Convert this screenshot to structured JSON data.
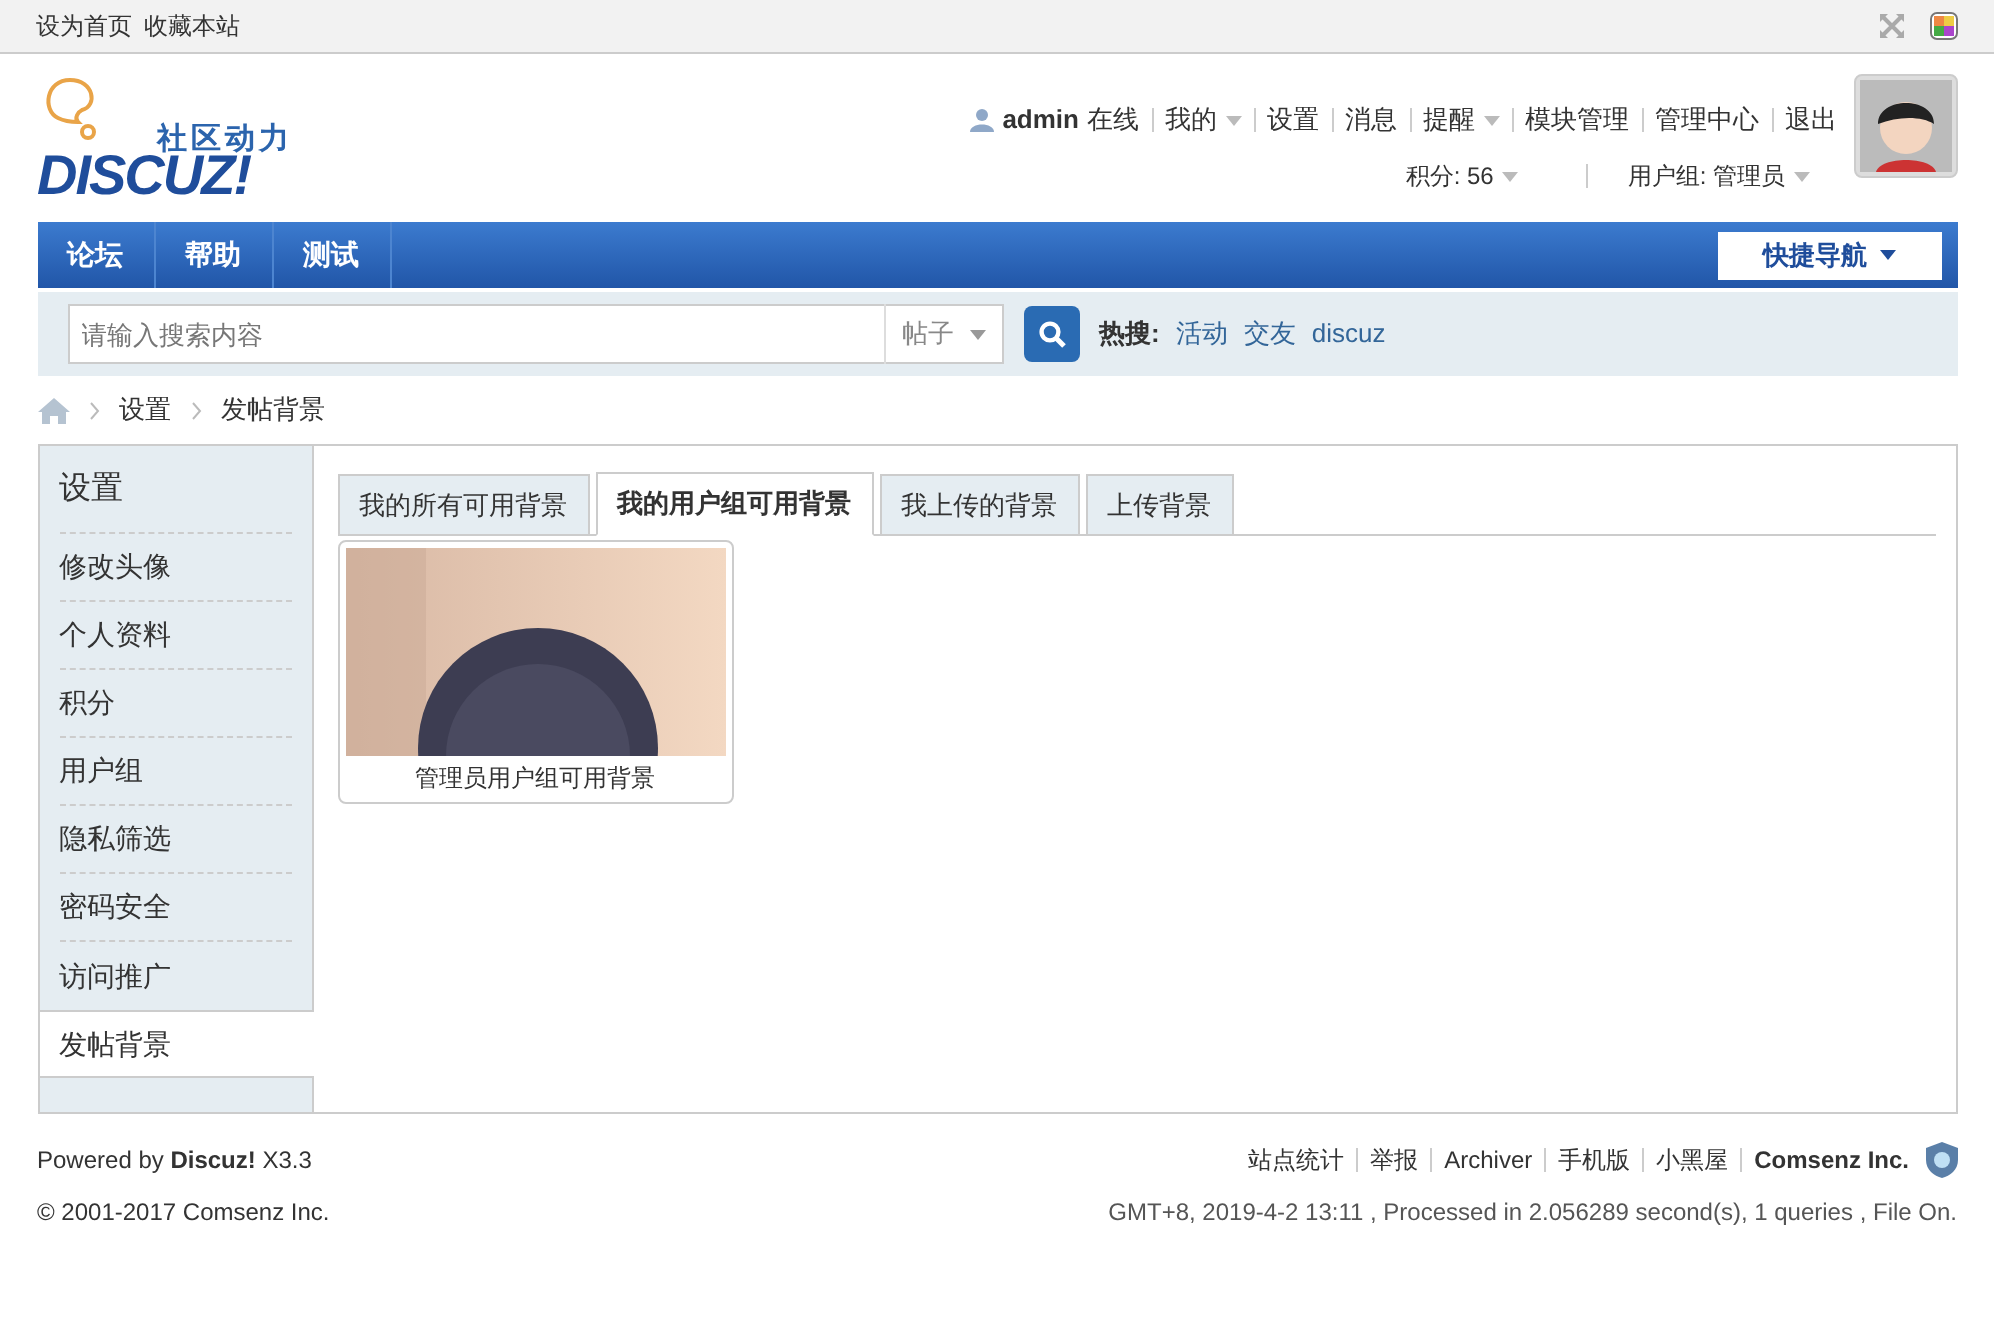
{
  "topbar": {
    "links": [
      "设为首页",
      "收藏本站"
    ]
  },
  "logo": {
    "tagline": "社区动力",
    "wordmark": "DISCUZ!"
  },
  "user_menu": {
    "username": "admin",
    "status": "在线",
    "items": [
      {
        "label": "我的",
        "dropdown": true
      },
      {
        "label": "设置",
        "dropdown": false
      },
      {
        "label": "消息",
        "dropdown": false
      },
      {
        "label": "提醒",
        "dropdown": true
      },
      {
        "label": "模块管理",
        "dropdown": false
      },
      {
        "label": "管理中心",
        "dropdown": false
      },
      {
        "label": "退出",
        "dropdown": false
      }
    ]
  },
  "user_info": [
    {
      "label": "积分: 56",
      "dropdown": true
    },
    {
      "label": "用户组: 管理员",
      "dropdown": true
    }
  ],
  "nav": {
    "items": [
      "论坛",
      "帮助",
      "测试"
    ],
    "quick_nav": "快捷导航"
  },
  "search": {
    "placeholder": "请输入搜索内容",
    "type": "帖子",
    "hot_label": "热搜:",
    "hot": [
      "活动",
      "交友",
      "discuz"
    ]
  },
  "breadcrumb": [
    "设置",
    "发帖背景"
  ],
  "sidebar": {
    "title": "设置",
    "items": [
      {
        "label": "修改头像",
        "selected": false
      },
      {
        "label": "个人资料",
        "selected": false
      },
      {
        "label": "积分",
        "selected": false
      },
      {
        "label": "用户组",
        "selected": false
      },
      {
        "label": "隐私筛选",
        "selected": false
      },
      {
        "label": "密码安全",
        "selected": false
      },
      {
        "label": "访问推广",
        "selected": false
      },
      {
        "label": "发帖背景",
        "selected": true
      }
    ]
  },
  "tabs": [
    {
      "label": "我的所有可用背景",
      "selected": false
    },
    {
      "label": "我的用户组可用背景",
      "selected": true
    },
    {
      "label": "我上传的背景",
      "selected": false
    },
    {
      "label": "上传背景",
      "selected": false
    }
  ],
  "backgrounds": [
    {
      "kind": "picture",
      "caption": "管理员用户组可用背景"
    }
  ],
  "footer": {
    "powered": "Powered by **Discuz!** X3.3",
    "copyright": "© 2001-2017 Comsenz Inc.",
    "links": [
      {
        "label": "站点统计",
        "bold": false
      },
      {
        "label": "举报",
        "bold": false
      },
      {
        "label": "Archiver",
        "bold": false
      },
      {
        "label": "手机版",
        "bold": false
      },
      {
        "label": "小黑屋",
        "bold": false
      },
      {
        "label": "Comsenz Inc.",
        "bold": true
      }
    ],
    "info": "GMT+8, 2019-4-2 13:11 , Processed in 2.056289 second(s), 1 queries , File On."
  }
}
